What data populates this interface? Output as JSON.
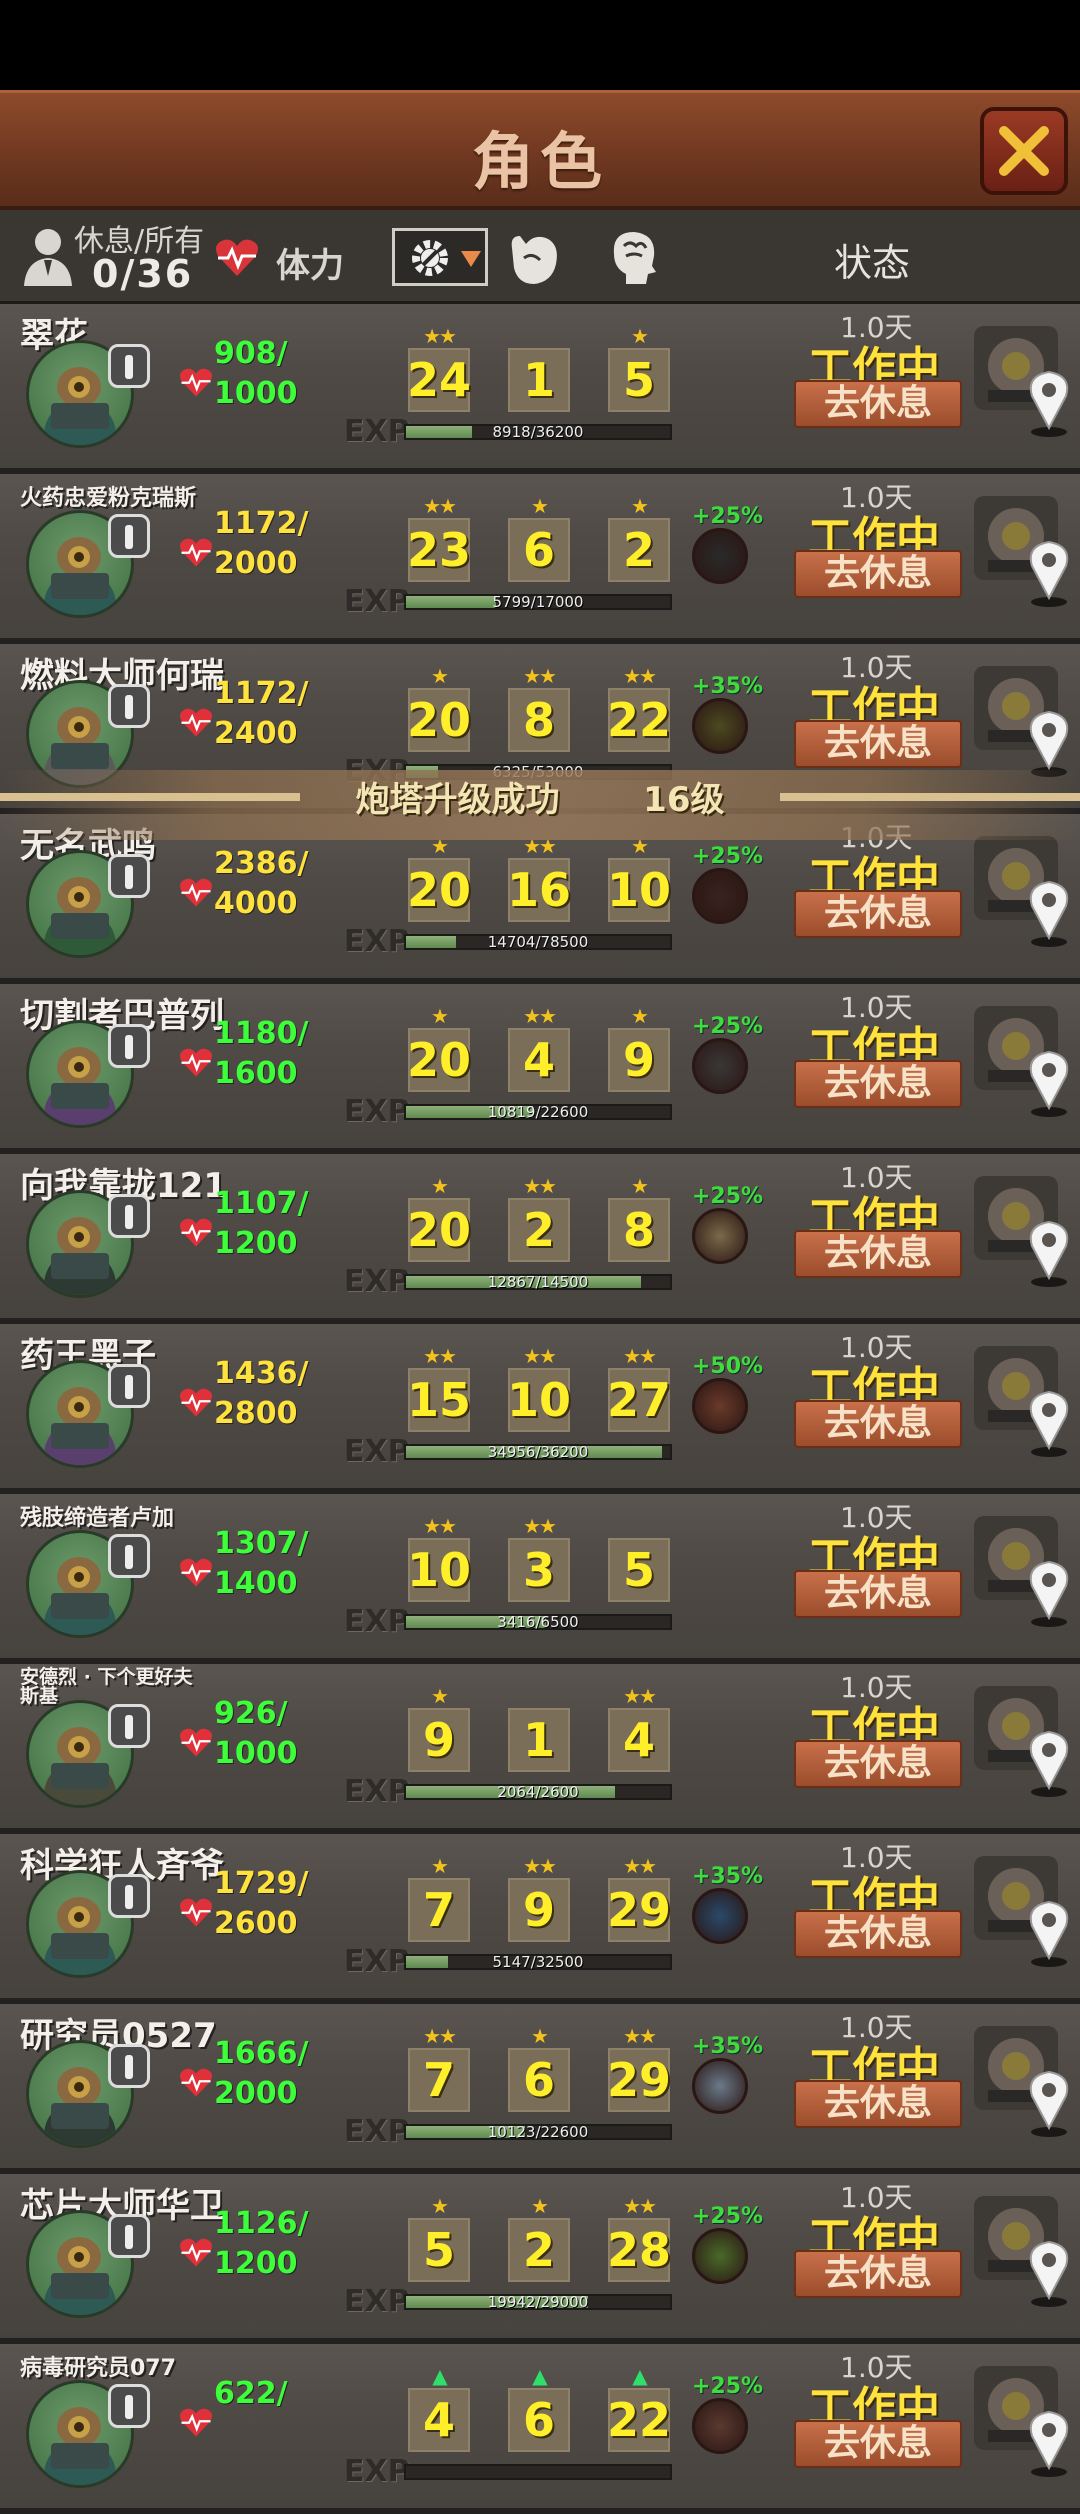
{
  "header": {
    "title": "角色"
  },
  "filter_bar": {
    "rest_all_label": "休息/所有",
    "rest_count": "0/36",
    "stamina_label": "体力",
    "status_label": "状态"
  },
  "rest_button_label": "去休息",
  "exp_label": "EXP",
  "notification": {
    "text": "炮塔升级成功",
    "level": "16级"
  },
  "rows": [
    {
      "name": "翠花",
      "hp_cur": "908/",
      "hp_max": "1000",
      "hp_color": "#3cff3a",
      "s1": "24",
      "s1_stars": 2,
      "s2": "1",
      "s2_stars": 0,
      "s3": "5",
      "s3_stars": 1,
      "exp_text": "8918/36200",
      "exp_frac": 0.25,
      "bonus": "",
      "days": "1.0天",
      "status": "工作中",
      "body": "#2e5a55",
      "item": "none"
    },
    {
      "name": "火药忠爱粉克瑞斯",
      "name_size": "small",
      "hp_cur": "1172/",
      "hp_max": "2000",
      "hp_color": "#ffe23c",
      "s1": "23",
      "s1_stars": 2,
      "s2": "6",
      "s2_stars": 1,
      "s3": "2",
      "s3_stars": 1,
      "exp_text": "5799/17000",
      "exp_frac": 0.34,
      "bonus": "+25%",
      "days": "1.0天",
      "status": "工作中",
      "body": "#2e5a55",
      "item": "coal"
    },
    {
      "name": "燃料大师何瑞",
      "hp_cur": "1172/",
      "hp_max": "2400",
      "hp_color": "#ffe23c",
      "s1": "20",
      "s1_stars": 1,
      "s2": "8",
      "s2_stars": 2,
      "s3": "22",
      "s3_stars": 2,
      "exp_text": "6325/53000",
      "exp_frac": 0.12,
      "bonus": "+35%",
      "days": "1.0天",
      "status": "工作中",
      "body": "#5a5a5a",
      "item": "canister"
    },
    {
      "name": "无名武鸣",
      "hp_cur": "2386/",
      "hp_max": "4000",
      "hp_color": "#ffe23c",
      "s1": "20",
      "s1_stars": 1,
      "s2": "16",
      "s2_stars": 2,
      "s3": "10",
      "s3_stars": 1,
      "exp_text": "14704/78500",
      "exp_frac": 0.19,
      "bonus": "+25%",
      "days": "1.0天",
      "status": "工作中",
      "body": "#2f5a38",
      "item": "gun"
    },
    {
      "name": "切割者巴普列",
      "hp_cur": "1180/",
      "hp_max": "1600",
      "hp_color": "#3cff3a",
      "s1": "20",
      "s1_stars": 1,
      "s2": "4",
      "s2_stars": 2,
      "s3": "9",
      "s3_stars": 1,
      "exp_text": "10819/22600",
      "exp_frac": 0.48,
      "bonus": "+25%",
      "days": "1.0天",
      "status": "工作中",
      "body": "#5a3f6e",
      "item": "saw"
    },
    {
      "name": "向我靠拢121",
      "hp_cur": "1107/",
      "hp_max": "1200",
      "hp_color": "#3cff3a",
      "s1": "20",
      "s1_stars": 1,
      "s2": "2",
      "s2_stars": 2,
      "s3": "8",
      "s3_stars": 1,
      "exp_text": "12867/14500",
      "exp_frac": 0.89,
      "bonus": "+25%",
      "days": "1.0天",
      "status": "工作中",
      "body": "#2d3a34",
      "item": "coins"
    },
    {
      "name": "药王黑子",
      "hp_cur": "1436/",
      "hp_max": "2800",
      "hp_color": "#ffe23c",
      "s1": "15",
      "s1_stars": 2,
      "s2": "10",
      "s2_stars": 2,
      "s3": "27",
      "s3_stars": 2,
      "exp_text": "34956/36200",
      "exp_frac": 0.97,
      "bonus": "+50%",
      "days": "1.0天",
      "status": "工作中",
      "body": "#5a3f6e",
      "item": "syringe"
    },
    {
      "name": "残肢缔造者卢加",
      "name_size": "small",
      "hp_cur": "1307/",
      "hp_max": "1400",
      "hp_color": "#3cff3a",
      "s1": "10",
      "s1_stars": 2,
      "s2": "3",
      "s2_stars": 2,
      "s3": "5",
      "s3_stars": 0,
      "exp_text": "3416/6500",
      "exp_frac": 0.53,
      "bonus": "",
      "days": "1.0天",
      "status": "工作中",
      "body": "#2e5a55",
      "item": "none"
    },
    {
      "name": "安德烈 · 下个更好夫斯基",
      "name_size": "tiny",
      "hp_cur": "926/",
      "hp_max": "1000",
      "hp_color": "#3cff3a",
      "s1": "9",
      "s1_stars": 1,
      "s2": "1",
      "s2_stars": 0,
      "s3": "4",
      "s3_stars": 2,
      "exp_text": "2064/2600",
      "exp_frac": 0.79,
      "bonus": "",
      "days": "1.0天",
      "status": "工作中",
      "body": "#4a4a3a",
      "item": "none"
    },
    {
      "name": "科学狂人斉爷",
      "hp_cur": "1729/",
      "hp_max": "2600",
      "hp_color": "#ffe23c",
      "s1": "7",
      "s1_stars": 1,
      "s2": "9",
      "s2_stars": 2,
      "s3": "29",
      "s3_stars": 2,
      "exp_text": "5147/32500",
      "exp_frac": 0.16,
      "bonus": "+35%",
      "days": "1.0天",
      "status": "工作中",
      "body": "#2e5a55",
      "item": "pen"
    },
    {
      "name": "研究员0527",
      "hp_cur": "1666/",
      "hp_max": "2000",
      "hp_color": "#3cff3a",
      "s1": "7",
      "s1_stars": 2,
      "s2": "6",
      "s2_stars": 1,
      "s3": "29",
      "s3_stars": 2,
      "exp_text": "10123/22600",
      "exp_frac": 0.45,
      "bonus": "+35%",
      "days": "1.0天",
      "status": "工作中",
      "body": "#2d3a34",
      "item": "flask"
    },
    {
      "name": "芯片大师华卫",
      "hp_cur": "1126/",
      "hp_max": "1200",
      "hp_color": "#3cff3a",
      "s1": "5",
      "s1_stars": 1,
      "s2": "2",
      "s2_stars": 1,
      "s3": "28",
      "s3_stars": 2,
      "exp_text": "19942/29000",
      "exp_frac": 0.69,
      "bonus": "+25%",
      "days": "1.0天",
      "status": "工作中",
      "body": "#2e5a55",
      "item": "chip"
    },
    {
      "name": "病毒研究员077",
      "name_size": "small",
      "hp_cur": "622/",
      "hp_max": "",
      "hp_color": "#3cff3a",
      "s1": "4",
      "s1_stars": 3,
      "s2": "6",
      "s2_stars": 3,
      "s3": "22",
      "s3_stars": 3,
      "exp_text": "",
      "exp_frac": 0,
      "bonus": "+25%",
      "days": "1.0天",
      "status": "工作中",
      "body": "#2e5a55",
      "item": "none"
    }
  ]
}
